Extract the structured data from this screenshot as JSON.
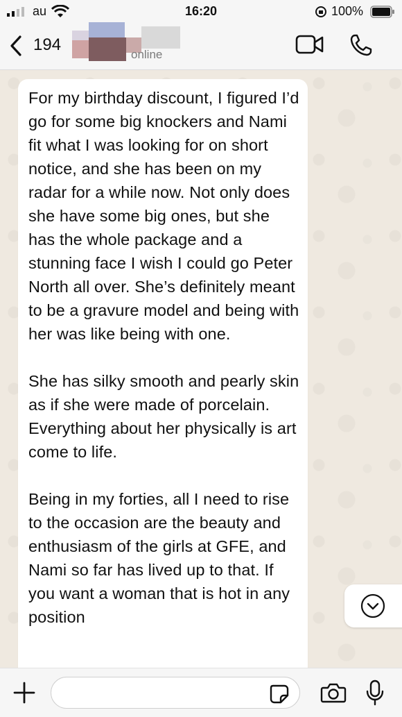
{
  "status_bar": {
    "carrier": "au",
    "time": "16:20",
    "battery_percent": "100%"
  },
  "header": {
    "back_icon": "chevron-left-icon",
    "contact_number": "194",
    "status": "online",
    "video_icon": "video-camera-icon",
    "call_icon": "phone-icon"
  },
  "message": {
    "paragraphs": [
      "For my birthday discount, I figured I’d go for some big knockers and Nami fit what I was looking for on short notice, and she has been on my radar for a while now. Not only does she have some big ones, but she has the whole package and a stunning face I wish I could go Peter North all over. She’s definitely meant to be a gravure model and being with her was like being with one.",
      "She has silky smooth and pearly skin as if she were made of porcelain. Everything about her physically is art come to life.",
      "Being in my forties, all I need to rise to the occasion are the beauty and enthusiasm of the girls at GFE, and Nami so far has lived up to that. If you want a woman that is hot in any position"
    ]
  },
  "input_bar": {
    "input_value": "",
    "icons": [
      "plus-icon",
      "sticker-icon",
      "camera-icon",
      "microphone-icon"
    ]
  },
  "colors": {
    "header_bg": "#f6f6f6",
    "wallpaper": "#efe9e0",
    "bubble": "#ffffff"
  }
}
